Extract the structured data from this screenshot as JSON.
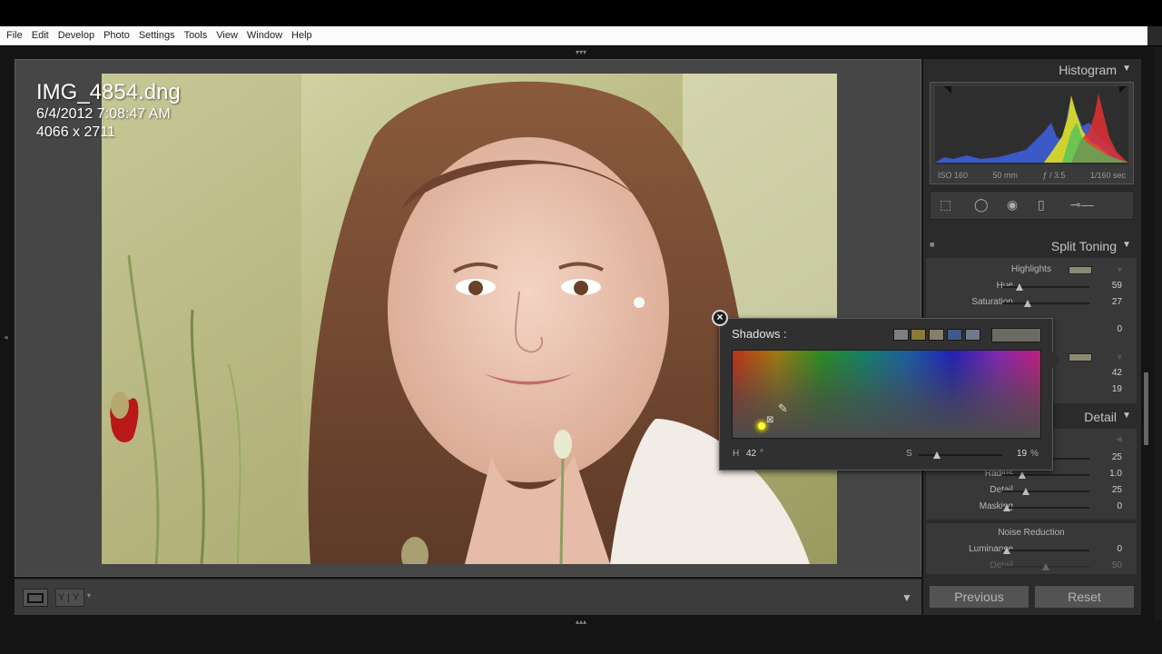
{
  "menu": [
    "File",
    "Edit",
    "Develop",
    "Photo",
    "Settings",
    "Tools",
    "View",
    "Window",
    "Help"
  ],
  "image_info": {
    "filename": "IMG_4854.dng",
    "datetime": "6/4/2012 7:08:47 AM",
    "dimensions": "4066 x 2711"
  },
  "histogram": {
    "title": "Histogram",
    "iso": "ISO 160",
    "focal": "50 mm",
    "aperture": "ƒ / 3.5",
    "shutter": "1/160 sec"
  },
  "split_toning": {
    "title": "Split Toning",
    "highlights_label": "Highlights",
    "hue_label": "Hue",
    "hue_value": "59",
    "sat_label": "Saturation",
    "sat_value": "27",
    "balance_value": "0",
    "shadows_hue_value": "42",
    "shadows_sat_value": "19"
  },
  "detail": {
    "title": "Detail",
    "amount_value": "25",
    "radius_label": "Radius",
    "radius_value": "1.0",
    "detail_label": "Detail",
    "detail_value": "25",
    "masking_label": "Masking",
    "masking_value": "0",
    "noise_reduction_label": "Noise Reduction",
    "luminance_label": "Luminance",
    "luminance_value": "0",
    "lum_detail_label": "Detail",
    "lum_detail_value": "50"
  },
  "buttons": {
    "previous": "Previous",
    "reset": "Reset"
  },
  "shadows_popup": {
    "title": "Shadows :",
    "h_label": "H",
    "h_value": "42",
    "h_unit": "°",
    "s_label": "S",
    "s_value": "19",
    "s_unit": "%",
    "swatch_colors": [
      "#7f7f7f",
      "#8a7a3a",
      "#857f6a",
      "#3f5a8a",
      "#6f7a8a"
    ],
    "selected_color": "#6b6a64"
  },
  "toolbar": {
    "view_toggle": "Y|Y"
  }
}
